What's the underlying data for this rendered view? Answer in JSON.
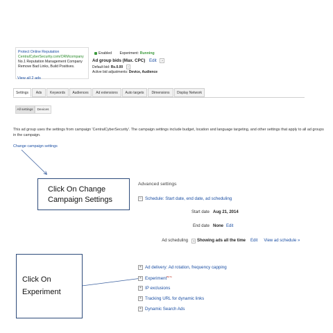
{
  "ad_preview": {
    "headline": "Protect Online Reputation",
    "display_url": "CentralCyberSecurity.com/ORMcompany",
    "line1": "No.1 Reputation Management Company",
    "line2": "Remove Bad Links, Build Positives.",
    "view_all": "View all 2 ads"
  },
  "status": {
    "enabled_label": "Enabled",
    "experiment_label": "Experiment:",
    "experiment_value": "Running",
    "bids_title": "Ad group bids (Max. CPC)",
    "edit_label": "Edit",
    "help_label": "?",
    "default_bid_label": "Default bid:",
    "default_bid_value": "Rs.0.00",
    "adjustments_label": "Active bid adjustments:",
    "adjustments_value": "Device, Audience"
  },
  "tabs": [
    "Settings",
    "Ads",
    "Keywords",
    "Audiences",
    "Ad extensions",
    "Auto targets",
    "Dimensions",
    "Display Network"
  ],
  "subtabs": [
    "All settings",
    "Devices"
  ],
  "info_text": "This ad group uses the settings from campaign 'CentralCyberSecurity'. The campaign settings include budget, location and language targeting, and other settings that apply to all ad groups in the campaign.",
  "change_link": "Change campaign settings",
  "callouts": {
    "change_line1": "Click On Change",
    "change_line2": "Campaign Settings",
    "experiment_line1": "Click On",
    "experiment_line2": "Experiment"
  },
  "advanced": {
    "title": "Advanced settings",
    "schedule_header": "Schedule: Start date, end date, ad scheduling",
    "start_label": "Start date",
    "start_value": "Aug 21, 2014",
    "end_label": "End date",
    "end_value": "None",
    "end_edit": "Edit",
    "sched_label": "Ad scheduling",
    "sched_value": "Showing ads all the time",
    "sched_edit": "Edit",
    "sched_view": "View ad schedule »",
    "sections": [
      "Ad delivery: Ad rotation, frequency capping",
      "Experiment",
      "IP exclusions",
      "Tracking URL for dynamic links",
      "Dynamic Search Ads"
    ],
    "beta_label": "BETA"
  },
  "colors": {
    "link": "#1a4ea3",
    "status_green": "#3c9a3c",
    "callout_border": "#2c4a7a"
  }
}
